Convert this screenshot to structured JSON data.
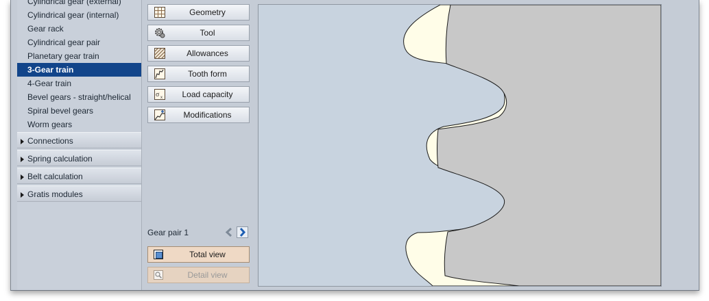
{
  "nav": {
    "items": [
      {
        "label": "Cylindrical gear (external)"
      },
      {
        "label": "Cylindrical gear (internal)"
      },
      {
        "label": "Gear rack"
      },
      {
        "label": "Cylindrical gear pair"
      },
      {
        "label": "Planetary gear train"
      },
      {
        "label": "3-Gear train"
      },
      {
        "label": "4-Gear train"
      },
      {
        "label": "Bevel gears - straight/helical"
      },
      {
        "label": "Spiral bevel gears"
      },
      {
        "label": "Worm gears"
      }
    ],
    "active_item": "3-Gear train",
    "sections": [
      {
        "label": "Connections"
      },
      {
        "label": "Spring calculation"
      },
      {
        "label": "Belt calculation"
      },
      {
        "label": "Gratis modules"
      }
    ]
  },
  "tools": {
    "buttons": [
      {
        "label": "Geometry",
        "icon": "grid-icon"
      },
      {
        "label": "Tool",
        "icon": "cog-tool-icon"
      },
      {
        "label": "Allowances",
        "icon": "hatch-icon"
      },
      {
        "label": "Tooth form",
        "icon": "tooth-form-icon"
      },
      {
        "label": "Load capacity",
        "icon": "load-icon"
      },
      {
        "label": "Modifications",
        "icon": "modification-icon"
      }
    ],
    "gear_pair_label": "Gear pair 1",
    "total_view_label": "Total view",
    "detail_view_label": "Detail view"
  },
  "colors": {
    "nav_active": "#12458a",
    "canvas_background": "#c8d3df",
    "gear_body": "#c8c8c8",
    "tooth_allowance": "#fffde6"
  }
}
